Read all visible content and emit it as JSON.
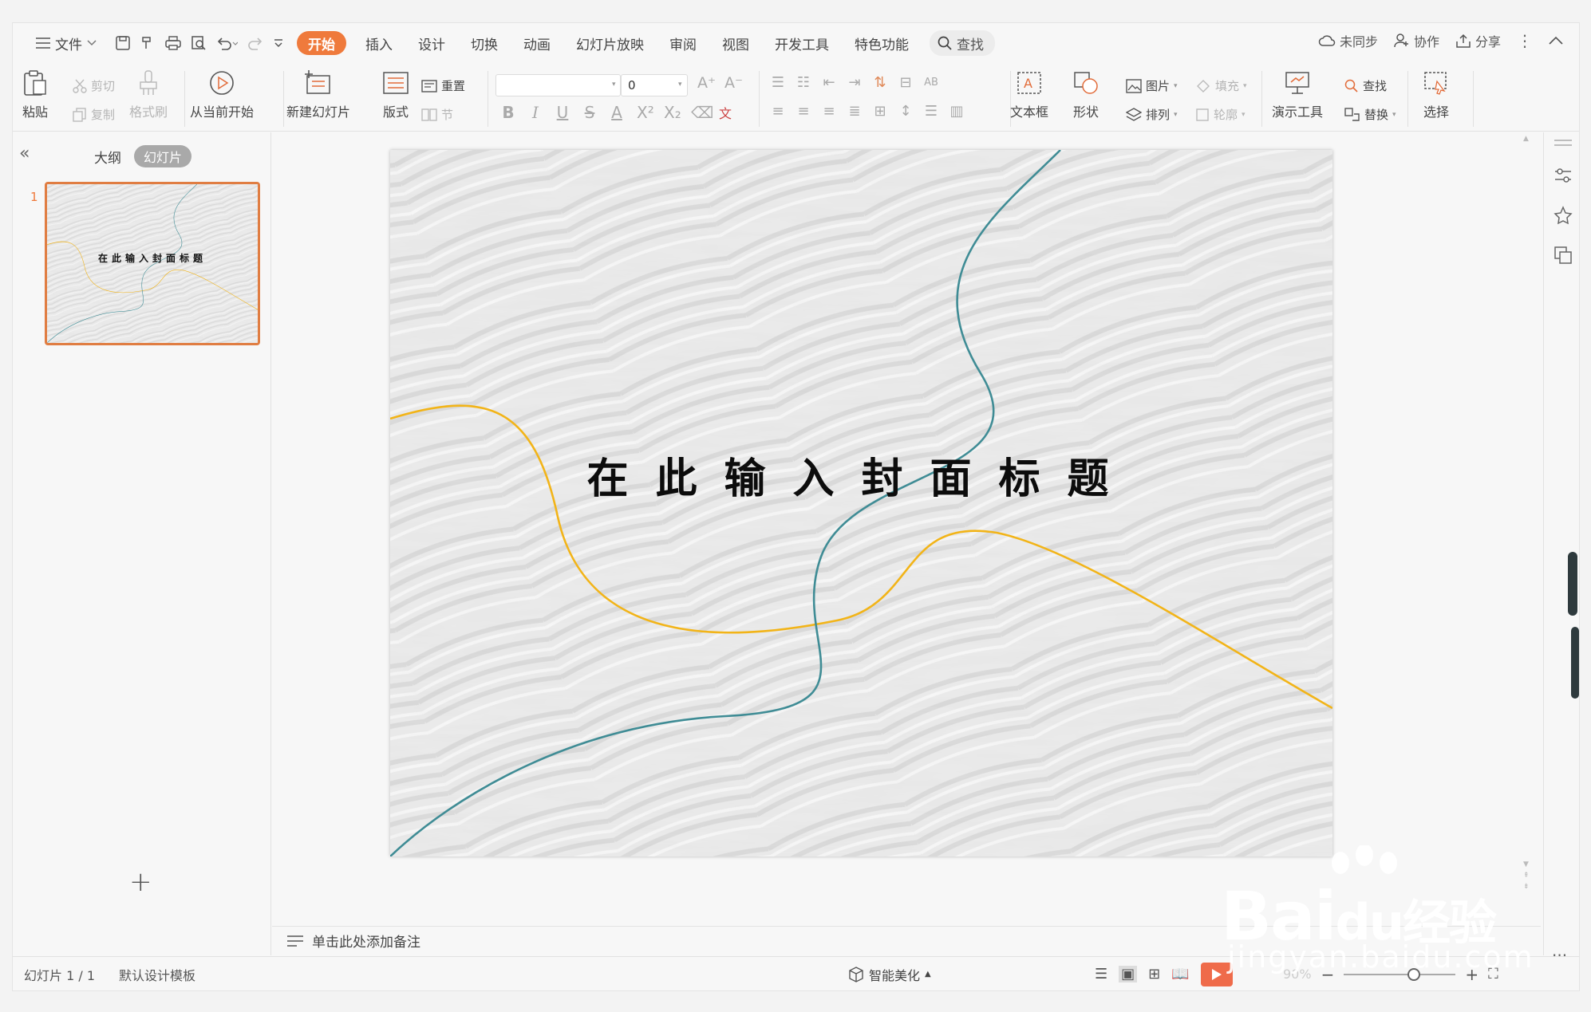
{
  "menu": {
    "file_label": "文件",
    "tabs": [
      "开始",
      "插入",
      "设计",
      "切换",
      "动画",
      "幻灯片放映",
      "审阅",
      "视图",
      "开发工具",
      "特色功能"
    ],
    "search_label": "查找",
    "right": {
      "sync": "未同步",
      "collab": "协作",
      "share": "分享"
    }
  },
  "ribbon": {
    "paste": "粘贴",
    "cut": "剪切",
    "copy": "复制",
    "format_painter": "格式刷",
    "play_from_current": "从当前开始",
    "new_slide": "新建幻灯片",
    "layout": "版式",
    "reset": "重置",
    "section": "节",
    "font_name": "",
    "font_size": "0",
    "textbox": "文本框",
    "shape": "形状",
    "picture": "图片",
    "fill": "填充",
    "arrange": "排列",
    "outline": "轮廓",
    "present_tools": "演示工具",
    "find": "查找",
    "replace": "替换",
    "select": "选择"
  },
  "panel": {
    "tab_outline": "大纲",
    "tab_slides": "幻灯片",
    "slide_number": "1",
    "thumb_title": "在此输入封面标题"
  },
  "slide": {
    "title": "在此输入封面标题"
  },
  "notes_placeholder": "单击此处添加备注",
  "status": {
    "slide_count": "幻灯片 1 / 1",
    "template": "默认设计模板",
    "smart_beautify": "智能美化",
    "zoom": "90%"
  },
  "watermark": {
    "brand": "Bai",
    "brand_suffix": "经验",
    "url": "jingyan.baidu.com"
  },
  "colors": {
    "accent": "#ef7a3c",
    "teal_curve": "#3f8c95",
    "gold_curve": "#f2b418"
  }
}
